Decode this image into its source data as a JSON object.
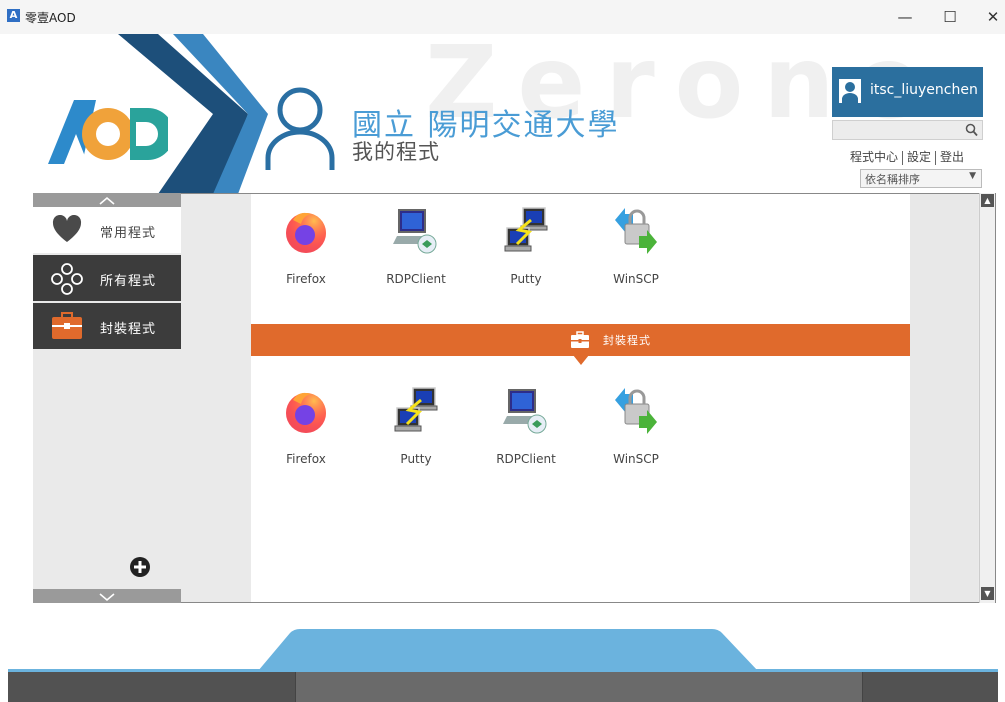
{
  "window": {
    "title": "零壹AOD",
    "icon_letter": "A",
    "minimize": "—",
    "maximize": "☐",
    "close": "✕"
  },
  "header": {
    "watermark": "Zerone",
    "school_name": "國立 陽明交通大學",
    "page_title": "我的程式",
    "user_name": "itsc_liuyenchen",
    "search_placeholder": "",
    "links": {
      "app_center": "程式中心",
      "settings": "設定",
      "logout": "登出"
    },
    "sort_label": "依名稱排序"
  },
  "sidebar": {
    "items": [
      {
        "label": "常用程式",
        "icon": "heart-icon"
      },
      {
        "label": "所有程式",
        "icon": "apps-grid-icon"
      },
      {
        "label": "封裝程式",
        "icon": "briefcase-icon"
      }
    ]
  },
  "favorites": [
    {
      "name": "Firefox",
      "icon": "firefox-icon"
    },
    {
      "name": "RDPClient",
      "icon": "rdp-client-icon"
    },
    {
      "name": "Putty",
      "icon": "putty-icon"
    },
    {
      "name": "WinSCP",
      "icon": "winscp-icon"
    }
  ],
  "packaged_section": {
    "label": "封裝程式",
    "apps": [
      {
        "name": "Firefox",
        "icon": "firefox-icon"
      },
      {
        "name": "Putty",
        "icon": "putty-icon"
      },
      {
        "name": "RDPClient",
        "icon": "rdp-client-icon"
      },
      {
        "name": "WinSCP",
        "icon": "winscp-icon"
      }
    ]
  },
  "colors": {
    "accent_orange": "#e06a2c",
    "brand_blue": "#4a9cd5",
    "user_box": "#2b6f9e"
  }
}
